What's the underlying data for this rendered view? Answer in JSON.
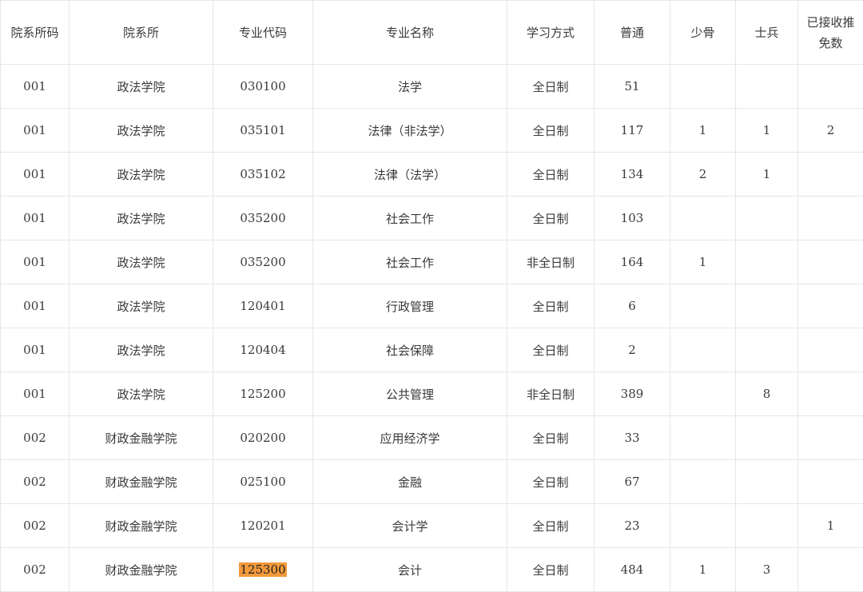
{
  "columns": [
    "院系所码",
    "院系所",
    "专业代码",
    "专业名称",
    "学习方式",
    "普通",
    "少骨",
    "士兵",
    "已接收推免数"
  ],
  "rows": [
    [
      "001",
      "政法学院",
      "030100",
      "法学",
      "全日制",
      "51",
      "",
      "",
      ""
    ],
    [
      "001",
      "政法学院",
      "035101",
      "法律（非法学）",
      "全日制",
      "117",
      "1",
      "1",
      "2"
    ],
    [
      "001",
      "政法学院",
      "035102",
      "法律（法学）",
      "全日制",
      "134",
      "2",
      "1",
      ""
    ],
    [
      "001",
      "政法学院",
      "035200",
      "社会工作",
      "全日制",
      "103",
      "",
      "",
      ""
    ],
    [
      "001",
      "政法学院",
      "035200",
      "社会工作",
      "非全日制",
      "164",
      "1",
      "",
      ""
    ],
    [
      "001",
      "政法学院",
      "120401",
      "行政管理",
      "全日制",
      "6",
      "",
      "",
      ""
    ],
    [
      "001",
      "政法学院",
      "120404",
      "社会保障",
      "全日制",
      "2",
      "",
      "",
      ""
    ],
    [
      "001",
      "政法学院",
      "125200",
      "公共管理",
      "非全日制",
      "389",
      "",
      "8",
      ""
    ],
    [
      "002",
      "财政金融学院",
      "020200",
      "应用经济学",
      "全日制",
      "33",
      "",
      "",
      ""
    ],
    [
      "002",
      "财政金融学院",
      "025100",
      "金融",
      "全日制",
      "67",
      "",
      "",
      ""
    ],
    [
      "002",
      "财政金融学院",
      "120201",
      "会计学",
      "全日制",
      "23",
      "",
      "",
      "1"
    ],
    [
      "002",
      "财政金融学院",
      "125300",
      "会计",
      "全日制",
      "484",
      "1",
      "3",
      ""
    ]
  ],
  "highlight_color": "#f39a3b",
  "highlighted_cell": "125300"
}
